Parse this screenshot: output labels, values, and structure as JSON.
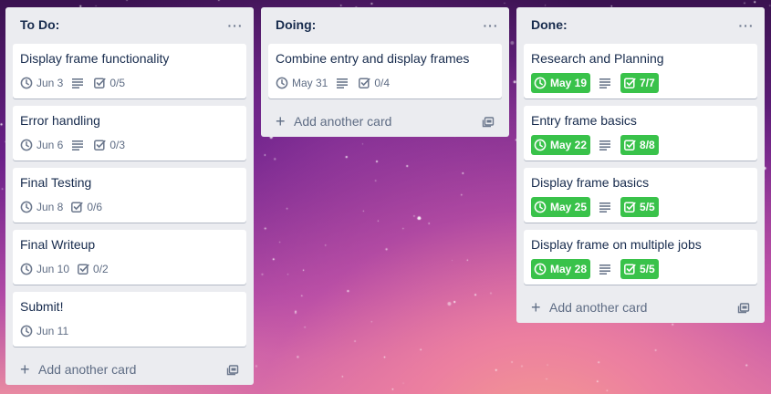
{
  "colors": {
    "list_bg": "#ebecf0",
    "card_bg": "#ffffff",
    "complete_green": "#39c24a",
    "text": "#172b4d",
    "muted": "#5e6c84"
  },
  "icons": {
    "menu": "ellipsis-icon",
    "due": "clock-icon",
    "description": "description-lines-icon",
    "checklist": "checkbox-icon",
    "add": "plus-icon",
    "template": "card-template-icon"
  },
  "lists": [
    {
      "title": "To Do:",
      "menu_label": "···",
      "add_card_label": "Add another card",
      "cards": [
        {
          "title": "Display frame functionality",
          "due": "Jun 3",
          "has_description": true,
          "checklist": "0/5",
          "complete": false
        },
        {
          "title": "Error handling",
          "due": "Jun 6",
          "has_description": true,
          "checklist": "0/3",
          "complete": false
        },
        {
          "title": "Final Testing",
          "due": "Jun 8",
          "has_description": false,
          "checklist": "0/6",
          "complete": false
        },
        {
          "title": "Final Writeup",
          "due": "Jun 10",
          "has_description": false,
          "checklist": "0/2",
          "complete": false
        },
        {
          "title": "Submit!",
          "due": "Jun 11",
          "has_description": false,
          "checklist": null,
          "complete": false
        }
      ]
    },
    {
      "title": "Doing:",
      "menu_label": "···",
      "add_card_label": "Add another card",
      "cards": [
        {
          "title": "Combine entry and display frames",
          "due": "May 31",
          "has_description": true,
          "checklist": "0/4",
          "complete": false
        }
      ]
    },
    {
      "title": "Done:",
      "menu_label": "···",
      "add_card_label": "Add another card",
      "cards": [
        {
          "title": "Research and Planning",
          "due": "May 19",
          "has_description": true,
          "checklist": "7/7",
          "complete": true
        },
        {
          "title": "Entry frame basics",
          "due": "May 22",
          "has_description": true,
          "checklist": "8/8",
          "complete": true
        },
        {
          "title": "Display frame basics",
          "due": "May 25",
          "has_description": true,
          "checklist": "5/5",
          "complete": true
        },
        {
          "title": "Display frame on multiple jobs",
          "due": "May 28",
          "has_description": true,
          "checklist": "5/5",
          "complete": true
        }
      ]
    }
  ]
}
